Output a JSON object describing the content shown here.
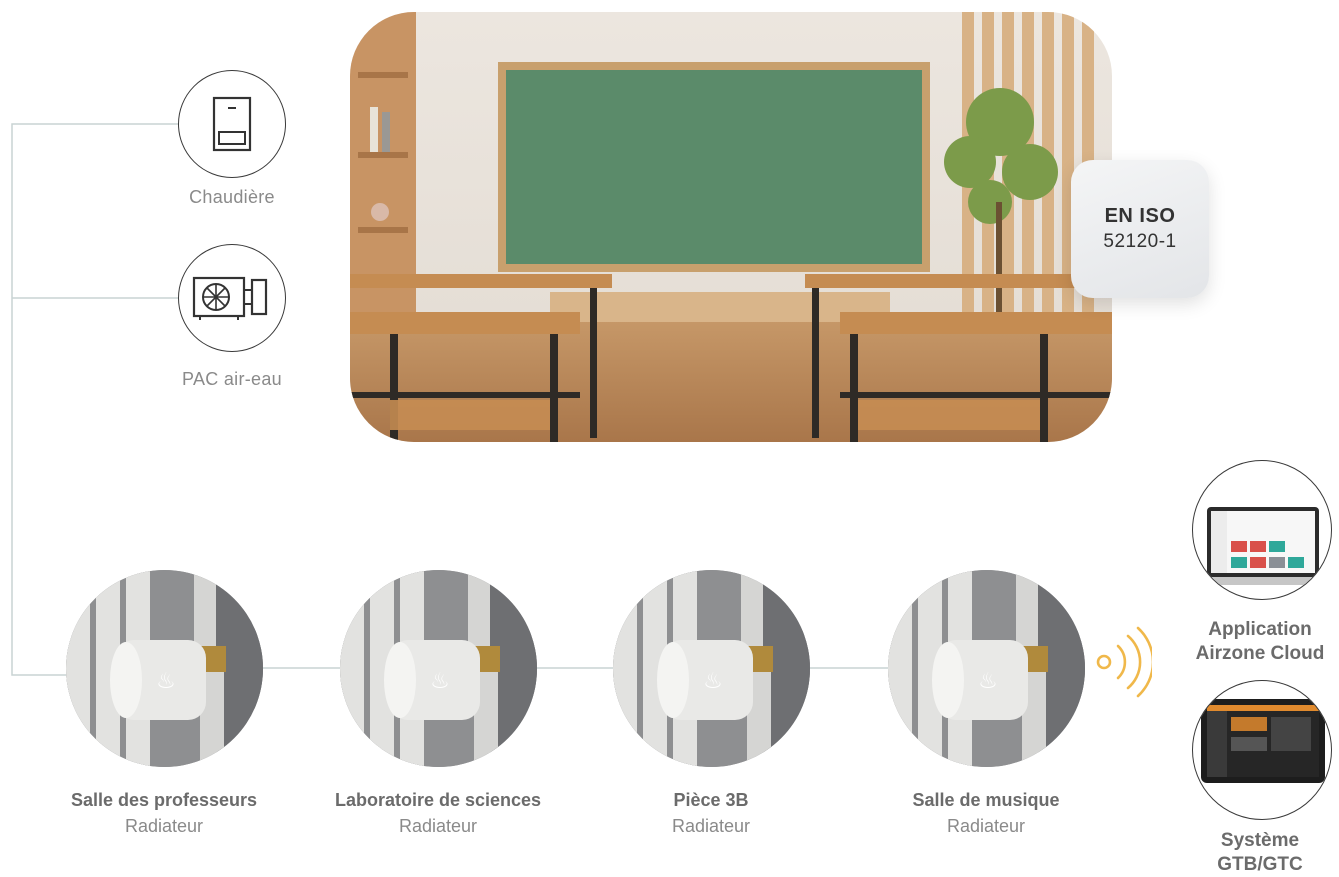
{
  "sources": [
    {
      "label": "Chaudière",
      "icon": "boiler-icon"
    },
    {
      "label": "PAC air-eau",
      "icon": "heat-pump-icon"
    }
  ],
  "badge": {
    "line1": "EN ISO",
    "line2": "52120-1"
  },
  "rooms": [
    {
      "title": "Salle des professeurs",
      "subtitle": "Radiateur"
    },
    {
      "title": "Laboratoire de sciences",
      "subtitle": "Radiateur"
    },
    {
      "title": "Pièce 3B",
      "subtitle": "Radiateur"
    },
    {
      "title": "Salle de musique",
      "subtitle": "Radiateur"
    }
  ],
  "apps": [
    {
      "line1": "Application",
      "line2": "Airzone Cloud"
    },
    {
      "line1": "Système",
      "line2": "GTB/GTC"
    }
  ],
  "colors": {
    "line": "#c9d3d3",
    "wireless": "#f0b84a",
    "text": "#6b6b6b"
  }
}
